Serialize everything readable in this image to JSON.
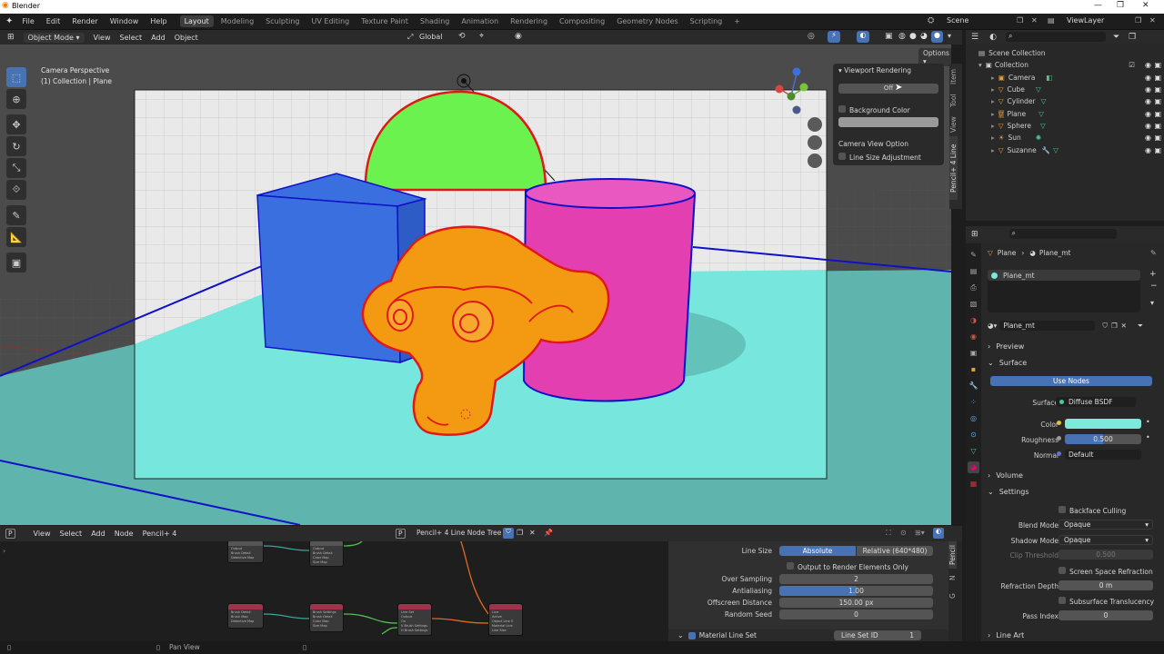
{
  "window": {
    "title": "Blender"
  },
  "menubar": {
    "menus": [
      "File",
      "Edit",
      "Render",
      "Window",
      "Help"
    ],
    "workspaces": [
      "Layout",
      "Modeling",
      "Sculpting",
      "UV Editing",
      "Texture Paint",
      "Shading",
      "Animation",
      "Rendering",
      "Compositing",
      "Geometry Nodes",
      "Scripting"
    ],
    "add_tab": "+",
    "scene": "Scene",
    "view_layer": "ViewLayer"
  },
  "viewport_header": {
    "mode": "Object Mode",
    "menus": [
      "View",
      "Select",
      "Add",
      "Object"
    ],
    "orientation": "Global",
    "options": "Options"
  },
  "viewport": {
    "camera_label": "Camera Perspective",
    "collection_label": "(1) Collection | Plane",
    "side_tabs": [
      "Item",
      "Tool",
      "View",
      "Pencil+ 4 Line"
    ]
  },
  "npanel": {
    "header": "Viewport Rendering",
    "off_button": "Off",
    "background_color": "Background Color",
    "camera_view_option": "Camera View Option",
    "line_size_adjustment": "Line Size Adjustment"
  },
  "outliner": {
    "root": "Scene Collection",
    "collection": "Collection",
    "items": [
      "Camera",
      "Cube",
      "Cylinder",
      "Plane",
      "Sphere",
      "Sun",
      "Suzanne"
    ]
  },
  "properties": {
    "breadcrumb_object": "Plane",
    "breadcrumb_material": "Plane_mt",
    "slot_name": "Plane_mt",
    "material_name": "Plane_mt",
    "sections": {
      "preview": "Preview",
      "surface": "Surface",
      "volume": "Volume",
      "settings": "Settings",
      "line_art": "Line Art"
    },
    "use_nodes": "Use Nodes",
    "surface_label": "Surface",
    "surface_value": "Diffuse BSDF",
    "color_label": "Color",
    "color_value": "#7de8dc",
    "roughness_label": "Roughness",
    "roughness_value": "0.500",
    "normal_label": "Normal",
    "normal_value": "Default",
    "backface_culling": "Backface Culling",
    "blend_mode_label": "Blend Mode",
    "blend_mode_value": "Opaque",
    "shadow_mode_label": "Shadow Mode",
    "shadow_mode_value": "Opaque",
    "clip_threshold_label": "Clip Threshold",
    "clip_threshold_value": "0.500",
    "screen_space_refraction": "Screen Space Refraction",
    "refraction_depth_label": "Refraction Depth",
    "refraction_depth_value": "0 m",
    "subsurface_translucency": "Subsurface Translucency",
    "pass_index_label": "Pass Index",
    "pass_index_value": "0"
  },
  "node_editor": {
    "editor_badge": "P",
    "menus": [
      "View",
      "Select",
      "Add",
      "Node",
      "Pencil+ 4"
    ],
    "tree_badge": "P",
    "tree_name": "Pencil+ 4 Line Node Tree",
    "nodes": [
      {
        "title": "Output",
        "rows": [
          "Brush Detail",
          "Detective Map"
        ]
      },
      {
        "title": "Output",
        "rows": [
          "Brush Detail",
          "Color Map",
          "Size Map"
        ]
      },
      {
        "title": "Brush Detail",
        "rows": [
          "Brush Map",
          "Detective Map"
        ]
      },
      {
        "title": "Brush Settings",
        "rows": [
          "Brush Detail",
          "Color Map",
          "Size Map"
        ]
      },
      {
        "title": "Line Set",
        "rows": [
          "Output",
          "On",
          "V Brush Settings",
          "H Brush Settings"
        ]
      },
      {
        "title": "Line",
        "rows": [
          "Active",
          "Object Line S",
          "Material Line",
          "Line Size"
        ]
      }
    ]
  },
  "node_panel": {
    "line_size_label": "Line Size",
    "line_size_absolute": "Absolute",
    "line_size_relative": "Relative (640*480)",
    "output_to_render": "Output to Render Elements Only",
    "over_sampling_label": "Over Sampling",
    "over_sampling_value": "2",
    "antialiasing_label": "Antialiasing",
    "antialiasing_value": "1.00",
    "offscreen_distance_label": "Offscreen Distance",
    "offscreen_distance_value": "150.00 px",
    "random_seed_label": "Random Seed",
    "random_seed_value": "0",
    "material_line_set": "Material Line Set",
    "line_set_id_label": "Line Set ID",
    "line_set_id_value": "1",
    "side_tabs": [
      "Pencil",
      "N",
      "G"
    ]
  },
  "statusbar": {
    "pan_view": "Pan View"
  },
  "colors": {
    "accent": "#4772b3",
    "cube": "#3a6fe0",
    "sphere": "#6cf24f",
    "cylinder": "#e43fb0",
    "suzanne": "#f39a12",
    "plane": "#77e6dc",
    "outline_red": "#e01818",
    "outline_blue": "#1010c8"
  }
}
